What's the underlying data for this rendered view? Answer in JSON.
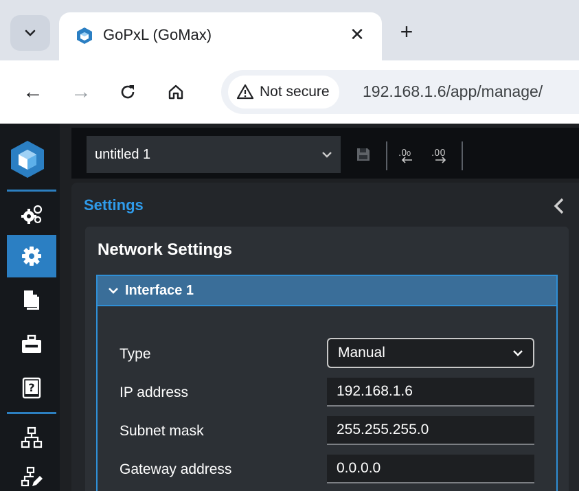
{
  "browser": {
    "tab": {
      "title": "GoPxL (GoMax)"
    },
    "address": {
      "security_label": "Not secure",
      "url": "192.168.1.6/app/manage/"
    }
  },
  "app": {
    "file_selector": {
      "value": "untitled 1"
    },
    "panel": {
      "title": "Settings"
    },
    "network": {
      "title": "Network Settings",
      "interface": {
        "title": "Interface 1",
        "fields": {
          "type": {
            "label": "Type",
            "value": "Manual"
          },
          "ip": {
            "label": "IP address",
            "value": "192.168.1.6"
          },
          "subnet": {
            "label": "Subnet mask",
            "value": "255.255.255.0"
          },
          "gateway": {
            "label": "Gateway address",
            "value": "0.0.0.0"
          }
        }
      }
    }
  },
  "colors": {
    "accent": "#2b7fc3",
    "title_blue": "#2f9bea",
    "interface_header": "#3a6e99"
  }
}
